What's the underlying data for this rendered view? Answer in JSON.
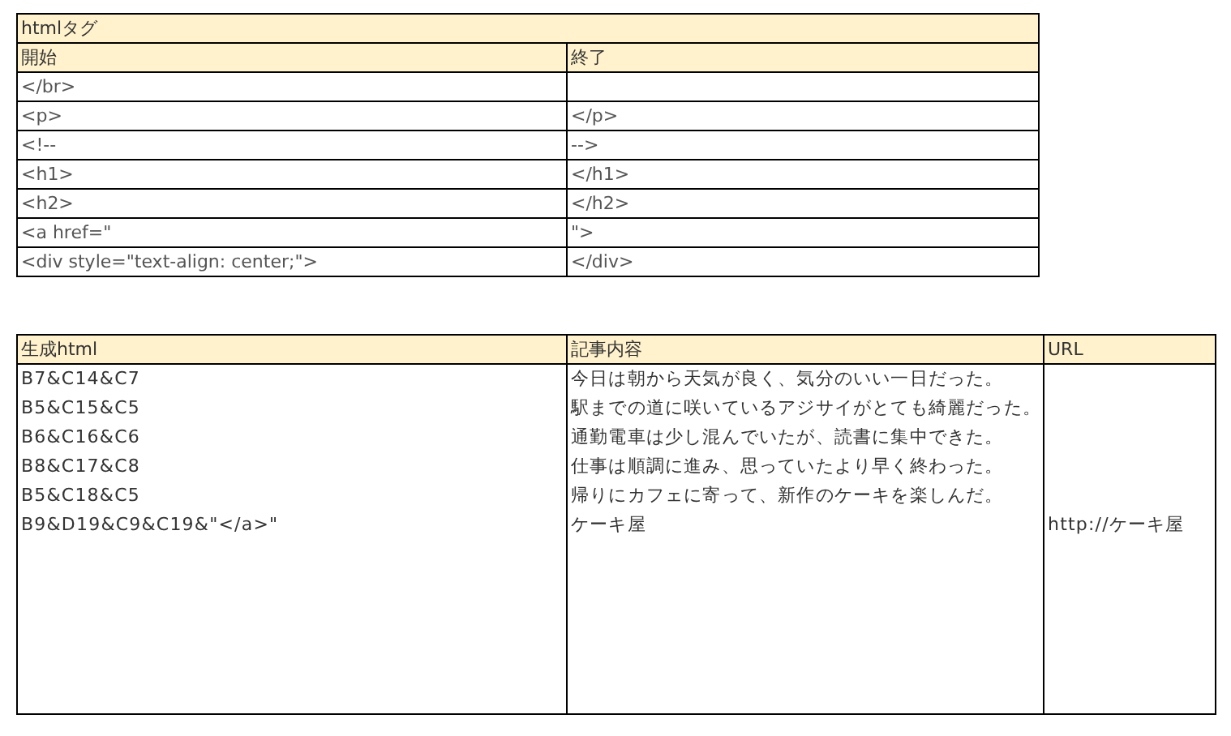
{
  "tag_table": {
    "title": "htmlタグ",
    "columns": [
      "開始",
      "終了"
    ],
    "rows": [
      {
        "start": "</br>"
      },
      {
        "start": "<p>",
        "end": "</p>"
      },
      {
        "start": "<!--",
        "end": " -->"
      },
      {
        "start": "<h1>",
        "end": "</h1>"
      },
      {
        "start": "<h2>",
        "end": "</h2>"
      },
      {
        "start": "<a href=\"",
        "end": "\">"
      },
      {
        "start": "<div style=\"text-align: center;\">",
        "end": "</div>"
      }
    ]
  },
  "generated_table": {
    "columns": [
      "生成html",
      "記事内容",
      "URL"
    ],
    "rows": [
      {
        "html": "B7&C14&C7",
        "article": "今日は朝から天気が良く、気分のいい一日だった。"
      },
      {
        "html": "B5&C15&C5",
        "article": "駅までの道に咲いているアジサイがとても綺麗だった。"
      },
      {
        "html": "B6&C16&C6",
        "article": "通勤電車は少し混んでいたが、読書に集中できた。"
      },
      {
        "html": "B8&C17&C8",
        "article": "仕事は順調に進み、思っていたより早く終わった。"
      },
      {
        "html": "B5&C18&C5",
        "article": "帰りにカフェに寄って、新作のケーキを楽しんだ。"
      },
      {
        "html": "B9&D19&C9&C19&\"</a>\"",
        "article": "ケーキ屋",
        "url": "http://ケーキ屋"
      }
    ]
  }
}
